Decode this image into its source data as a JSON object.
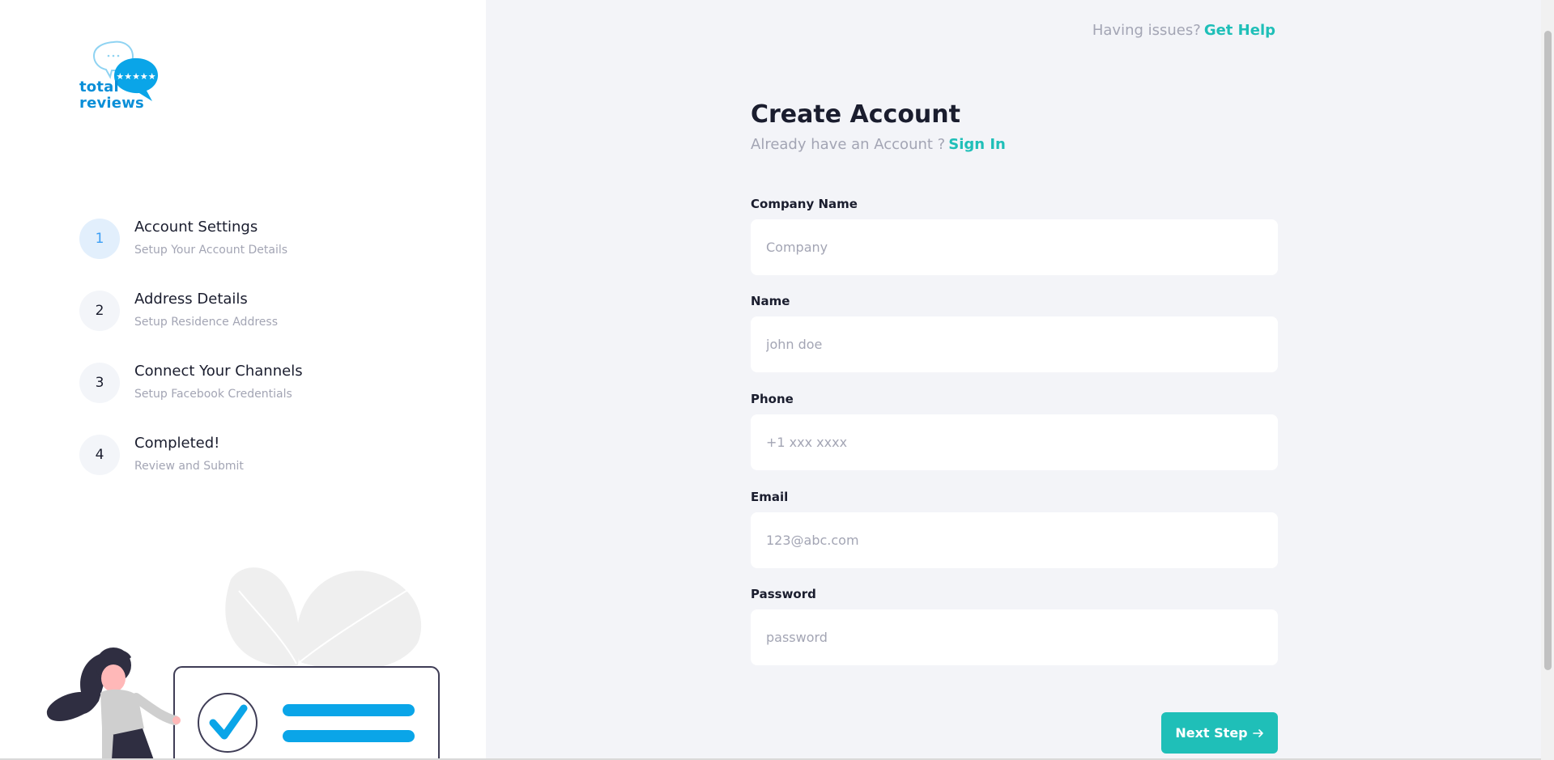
{
  "help": {
    "text": "Having issues?",
    "link": "Get Help"
  },
  "logo": {
    "line1": "total",
    "line2": "reviews"
  },
  "steps": [
    {
      "num": "1",
      "title": "Account Settings",
      "subtitle": "Setup Your Account Details"
    },
    {
      "num": "2",
      "title": "Address Details",
      "subtitle": "Setup Residence Address"
    },
    {
      "num": "3",
      "title": "Connect Your Channels",
      "subtitle": "Setup Facebook Credentials"
    },
    {
      "num": "4",
      "title": "Completed!",
      "subtitle": "Review and Submit"
    }
  ],
  "form": {
    "title": "Create Account",
    "subtitle": "Already have an Account ?",
    "signin": "Sign In",
    "fields": [
      {
        "label": "Company Name",
        "placeholder": "Company",
        "value": ""
      },
      {
        "label": "Name",
        "placeholder": "john doe",
        "value": ""
      },
      {
        "label": "Phone",
        "placeholder": "+1 xxx xxxx",
        "value": ""
      },
      {
        "label": "Email",
        "placeholder": "123@abc.com",
        "value": ""
      },
      {
        "label": "Password",
        "placeholder": "password",
        "value": ""
      }
    ],
    "next_label": "Next Step",
    "next_icon": "arrow-right-icon"
  },
  "colors": {
    "accent": "#1fbfb8",
    "brand": "#0aa5e8",
    "text": "#1a1d2e",
    "muted": "#a3a5b4",
    "step_active_bg": "#e2effc",
    "step_active_text": "#3b9ef5"
  }
}
